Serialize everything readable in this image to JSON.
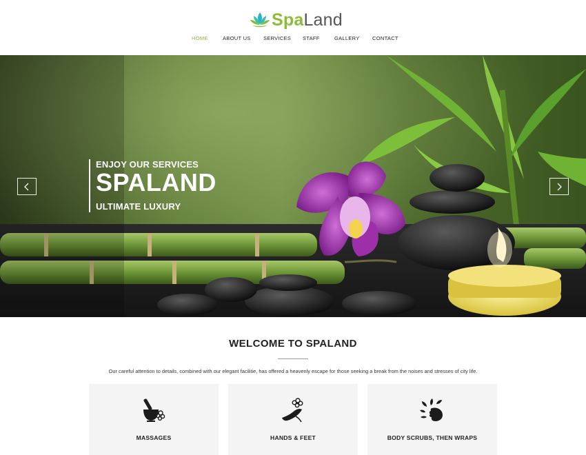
{
  "brand": {
    "name_part1": "Spa",
    "name_part2": "Land",
    "logo_icon": "lotus-icon",
    "accent": "#8dbb3a"
  },
  "nav": {
    "items": [
      {
        "label": "HOME",
        "active": true
      },
      {
        "label": "ABOUT US",
        "active": false
      },
      {
        "label": "SERVICES",
        "active": false
      },
      {
        "label": "STAFF",
        "active": false
      },
      {
        "label": "GALLERY",
        "active": false
      },
      {
        "label": "CONTACT",
        "active": false
      }
    ]
  },
  "hero": {
    "kicker": "ENJOY OUR SERVICES",
    "title": "SPALAND",
    "subtitle": "ULTIMATE LUXURY",
    "prev_icon": "chevron-left-icon",
    "next_icon": "chevron-right-icon"
  },
  "welcome": {
    "title": "WELCOME TO SPALAND",
    "text": "Our careful attention to details, combined with our elegant facilitie, has offered a heavenly escape for those seeking a break from the noises and stresses of city life."
  },
  "services": [
    {
      "label": "MASSAGES",
      "icon": "mortar-pestle-icon"
    },
    {
      "label": "HANDS & FEET",
      "icon": "foot-flower-icon"
    },
    {
      "label": "BODY SCRUBS, THEN WRAPS",
      "icon": "face-leaves-icon"
    }
  ]
}
